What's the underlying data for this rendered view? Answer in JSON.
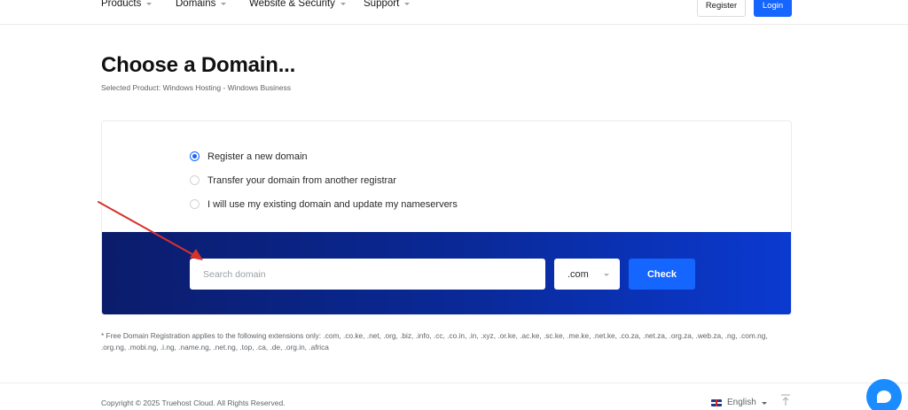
{
  "nav": {
    "items": [
      {
        "label": "Products"
      },
      {
        "label": "Domains"
      },
      {
        "label": "Website & Security"
      },
      {
        "label": "Support"
      }
    ],
    "register_label": "Register",
    "login_label": "Login"
  },
  "page": {
    "title": "Choose a Domain...",
    "subtitle": "Selected Product: Windows Hosting - Windows Business"
  },
  "options": [
    {
      "label": "Register a new domain",
      "checked": true
    },
    {
      "label": "Transfer your domain from another registrar",
      "checked": false
    },
    {
      "label": "I will use my existing domain and update my nameservers",
      "checked": false
    }
  ],
  "search": {
    "placeholder": "Search domain",
    "tld": ".com",
    "check_label": "Check"
  },
  "note": "* Free Domain Registration applies to the following extensions only: .com, .co.ke, .net, .org, .biz, .info, .cc, .co.in, .in, .xyz, .or.ke, .ac.ke, .sc.ke, .me.ke, .net.ke, .co.za, .net.za, .org.za, .web.za, .ng, .com.ng, .org.ng, .mobi.ng, .i.ng, .name.ng, .net.ng, .top, .ca, .de, .org.in, .africa",
  "footer": {
    "copyright": "Copyright © 2025 Truehost Cloud. All Rights Reserved.",
    "language": "English"
  },
  "colors": {
    "accent": "#1565ff",
    "band_start": "#0b1c6b",
    "band_end": "#0b3ad1",
    "annotation_arrow": "#d8322b"
  },
  "icons": [
    "caret-down-icon",
    "radio-icon",
    "uk-flag-icon",
    "scroll-to-top-icon",
    "chat-icon"
  ]
}
